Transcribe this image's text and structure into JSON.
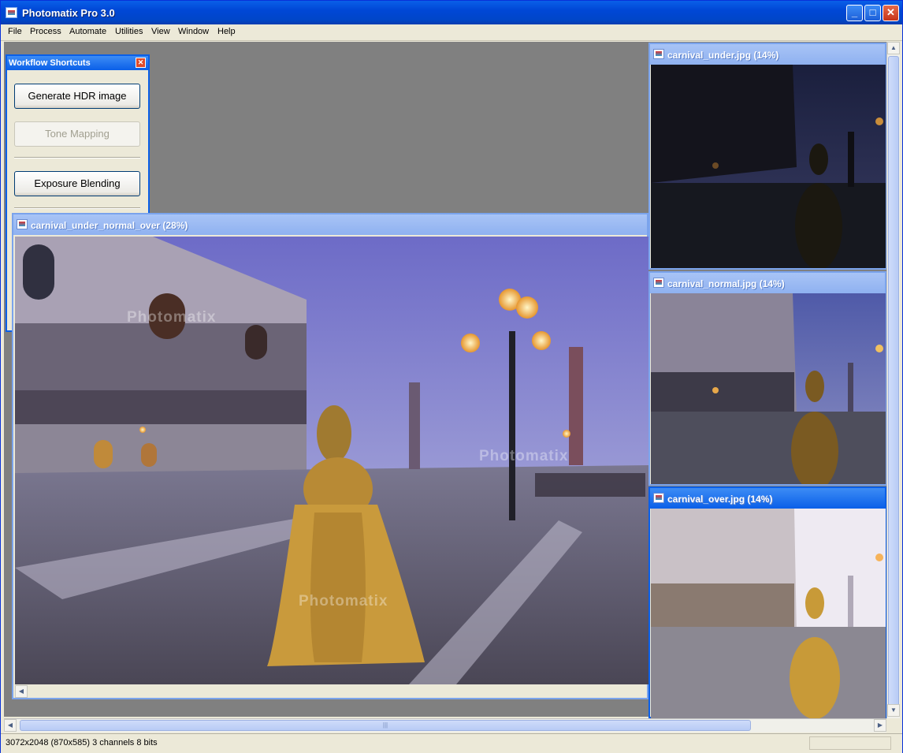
{
  "window": {
    "title": "Photomatix Pro 3.0"
  },
  "menu": {
    "items": [
      "File",
      "Process",
      "Automate",
      "Utilities",
      "View",
      "Window",
      "Help"
    ]
  },
  "workflow": {
    "title": "Workflow Shortcuts",
    "buttons": {
      "generate_hdr": "Generate HDR image",
      "tone_mapping": "Tone Mapping",
      "exposure_blending": "Exposure Blending"
    }
  },
  "documents": {
    "main": {
      "title": "carnival_under_normal_over (28%)",
      "watermark": "Photomatix"
    },
    "under": {
      "title": "carnival_under.jpg (14%)"
    },
    "normal": {
      "title": "carnival_normal.jpg (14%)"
    },
    "over": {
      "title": "carnival_over.jpg (14%)"
    }
  },
  "status": {
    "text": "3072x2048 (870x585) 3 channels 8 bits"
  },
  "icons": [
    "app-icon",
    "minimize-icon",
    "maximize-icon",
    "close-icon",
    "document-icon",
    "scroll-left-arrow-icon",
    "scroll-right-arrow-icon",
    "scroll-up-arrow-icon",
    "scroll-down-arrow-icon"
  ]
}
